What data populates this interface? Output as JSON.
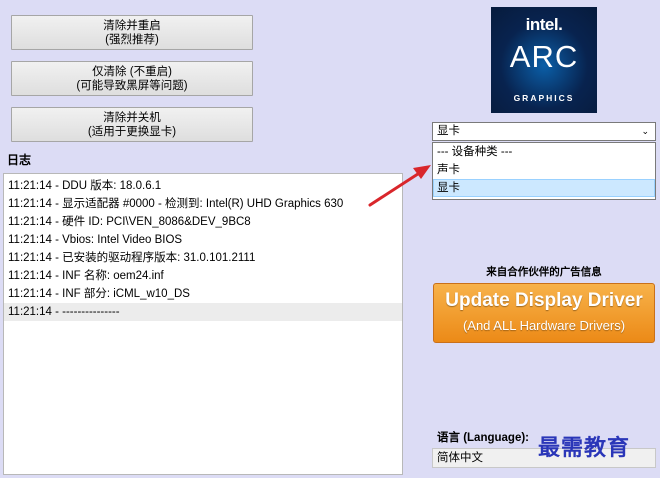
{
  "buttons": {
    "clean_restart": {
      "line1": "清除并重启",
      "line2": "(强烈推荐)"
    },
    "clean_only": {
      "line1": "仅清除 (不重启)",
      "line2": "(可能导致黑屏等问题)"
    },
    "clean_shutdown": {
      "line1": "清除并关机",
      "line2": "(适用于更换显卡)"
    }
  },
  "log": {
    "label": "日志",
    "rows": [
      "11:21:14 - DDU 版本: 18.0.6.1",
      "11:21:14 - 显示适配器 #0000 - 检测到: Intel(R) UHD Graphics 630",
      "11:21:14 - 硬件 ID: PCI\\VEN_8086&DEV_9BC8",
      "11:21:14 - Vbios: Intel Video BIOS",
      "11:21:14 - 已安装的驱动程序版本: 31.0.101.2111",
      "11:21:14 - INF 名称: oem24.inf",
      "11:21:14 - INF 部分: iCML_w10_DS",
      "11:21:14 - ---------------"
    ]
  },
  "logo": {
    "brand": "intel.",
    "product": "ARC",
    "sub": "GRAPHICS"
  },
  "device_type": {
    "selected": "显卡",
    "options": [
      "--- 设备种类 ---",
      "声卡",
      "显卡"
    ],
    "highlighted_index": 2
  },
  "ad": {
    "label": "来自合作伙伴的广告信息",
    "line1": "Update Display Driver",
    "line2": "(And ALL Hardware Drivers)"
  },
  "language": {
    "label": "语言 (Language):",
    "value": "简体中文"
  },
  "watermark": "最需教育",
  "colors": {
    "background": "#dcdcf5",
    "ad_orange": "#ec8a17",
    "arrow_red": "#d9262b",
    "watermark_blue": "#2a36b8"
  }
}
